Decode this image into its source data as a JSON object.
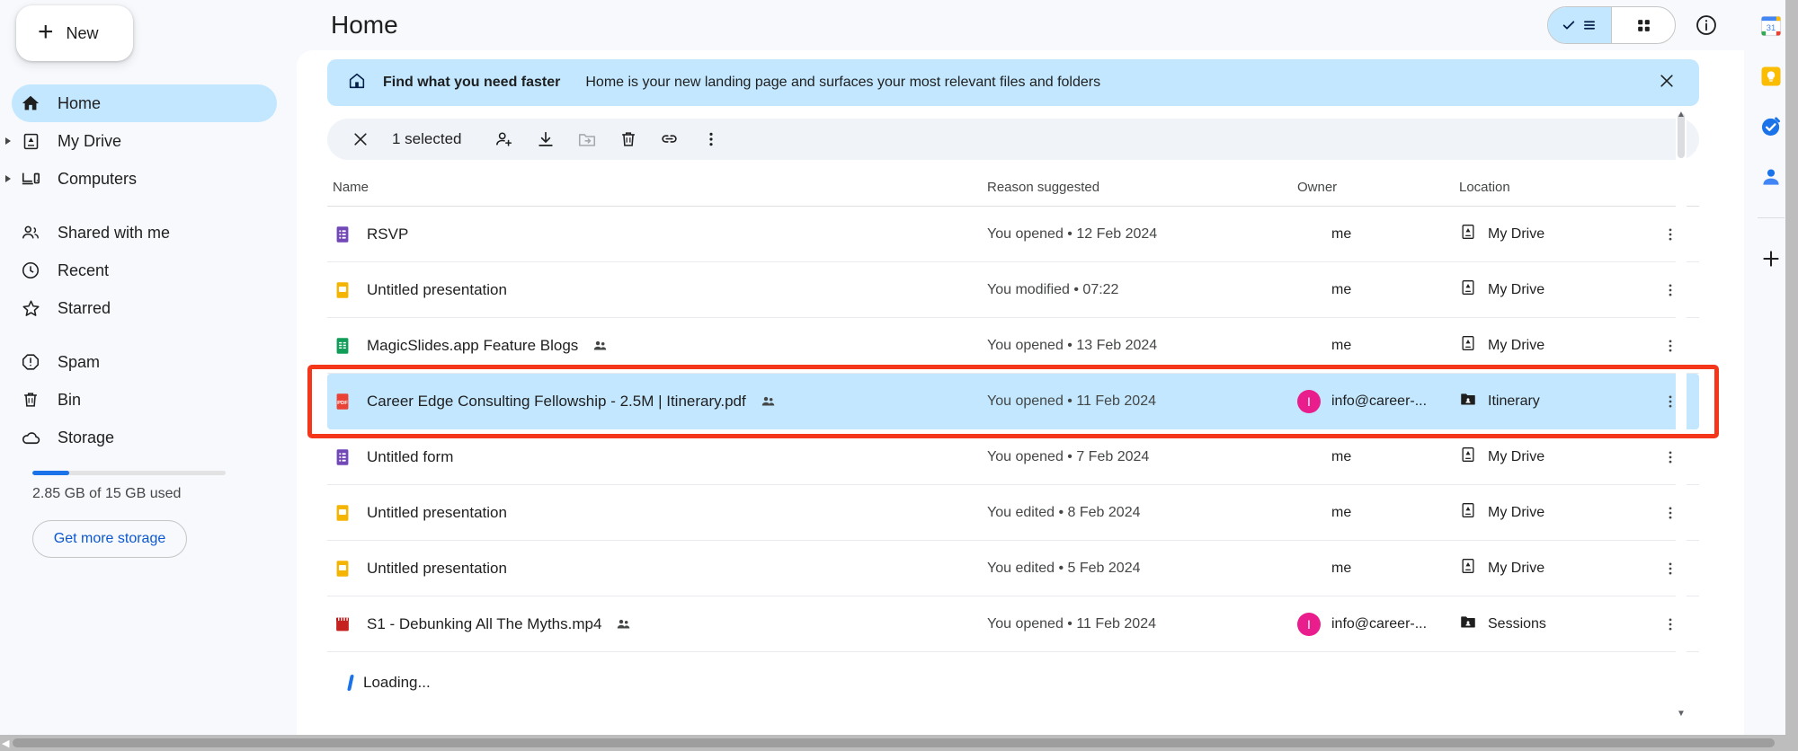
{
  "sidebar": {
    "new_button": "New",
    "items": [
      {
        "label": "Home",
        "icon": "home-icon",
        "active": true,
        "expandable": false
      },
      {
        "label": "My Drive",
        "icon": "drive-icon",
        "active": false,
        "expandable": true
      },
      {
        "label": "Computers",
        "icon": "computer-icon",
        "active": false,
        "expandable": true
      },
      {
        "label": "Shared with me",
        "icon": "people-icon",
        "active": false,
        "expandable": false
      },
      {
        "label": "Recent",
        "icon": "clock-icon",
        "active": false,
        "expandable": false
      },
      {
        "label": "Starred",
        "icon": "star-icon",
        "active": false,
        "expandable": false
      },
      {
        "label": "Spam",
        "icon": "spam-icon",
        "active": false,
        "expandable": false
      },
      {
        "label": "Bin",
        "icon": "trash-icon",
        "active": false,
        "expandable": false
      },
      {
        "label": "Storage",
        "icon": "cloud-icon",
        "active": false,
        "expandable": false
      }
    ],
    "storage": {
      "used_text": "2.85 GB of 15 GB used",
      "used_percent": 19,
      "get_more_label": "Get more storage",
      "bar_color": "#1a73e8"
    }
  },
  "header": {
    "title": "Home",
    "view_list_icon": "list-view-icon",
    "view_grid_icon": "grid-view-icon",
    "info_icon": "info-icon",
    "active_view": "list"
  },
  "banner": {
    "icon": "home-outline-icon",
    "strong": "Find what you need faster",
    "rest": "Home is your new landing page and surfaces your most relevant files and folders",
    "close_icon": "close-icon",
    "bg_color": "#c2e7ff"
  },
  "selection_toolbar": {
    "close_icon": "close-icon",
    "count_label": "1 selected",
    "actions": [
      {
        "name": "share-add-person-icon",
        "disabled": false
      },
      {
        "name": "download-icon",
        "disabled": false
      },
      {
        "name": "move-to-folder-icon",
        "disabled": true
      },
      {
        "name": "delete-icon",
        "disabled": false
      },
      {
        "name": "get-link-icon",
        "disabled": false
      },
      {
        "name": "more-actions-icon",
        "disabled": false
      }
    ]
  },
  "table": {
    "columns": [
      "Name",
      "Reason suggested",
      "Owner",
      "Location"
    ],
    "rows": [
      {
        "name": "RSVP",
        "type": "forms",
        "shared": false,
        "reason": "You opened • 12 Feb 2024",
        "owner": "me",
        "owner_avatar": null,
        "location": "My Drive",
        "location_icon": "drive-icon",
        "selected": false
      },
      {
        "name": "Untitled presentation",
        "type": "slides",
        "shared": false,
        "reason": "You modified • 07:22",
        "owner": "me",
        "owner_avatar": null,
        "location": "My Drive",
        "location_icon": "drive-icon",
        "selected": false
      },
      {
        "name": "MagicSlides.app Feature Blogs",
        "type": "sheets",
        "shared": true,
        "reason": "You opened • 13 Feb 2024",
        "owner": "me",
        "owner_avatar": null,
        "location": "My Drive",
        "location_icon": "drive-icon",
        "selected": false
      },
      {
        "name": "Career Edge Consulting Fellowship - 2.5M | Itinerary.pdf",
        "type": "pdf",
        "shared": true,
        "reason": "You opened • 11 Feb 2024",
        "owner": "info@career-...",
        "owner_avatar": "I",
        "location": "Itinerary",
        "location_icon": "folder-shared-icon",
        "selected": true
      },
      {
        "name": "Untitled form",
        "type": "forms",
        "shared": false,
        "reason": "You opened • 7 Feb 2024",
        "owner": "me",
        "owner_avatar": null,
        "location": "My Drive",
        "location_icon": "drive-icon",
        "selected": false
      },
      {
        "name": "Untitled presentation",
        "type": "slides",
        "shared": false,
        "reason": "You edited • 8 Feb 2024",
        "owner": "me",
        "owner_avatar": null,
        "location": "My Drive",
        "location_icon": "drive-icon",
        "selected": false
      },
      {
        "name": "Untitled presentation",
        "type": "slides",
        "shared": false,
        "reason": "You edited • 5 Feb 2024",
        "owner": "me",
        "owner_avatar": null,
        "location": "My Drive",
        "location_icon": "drive-icon",
        "selected": false
      },
      {
        "name": "S1 - Debunking All The Myths.mp4",
        "type": "video",
        "shared": true,
        "reason": "You opened • 11 Feb 2024",
        "owner": "info@career-...",
        "owner_avatar": "I",
        "location": "Sessions",
        "location_icon": "folder-shared-icon",
        "selected": false
      }
    ],
    "loading_label": "Loading..."
  },
  "right_rail": {
    "items": [
      {
        "name": "google-calendar-icon"
      },
      {
        "name": "google-keep-icon"
      },
      {
        "name": "google-tasks-icon"
      },
      {
        "name": "google-contacts-icon"
      },
      {
        "name": "add-apps-icon"
      }
    ]
  },
  "annotation": {
    "highlight_color": "#f4361b",
    "target_row_index": 3
  }
}
